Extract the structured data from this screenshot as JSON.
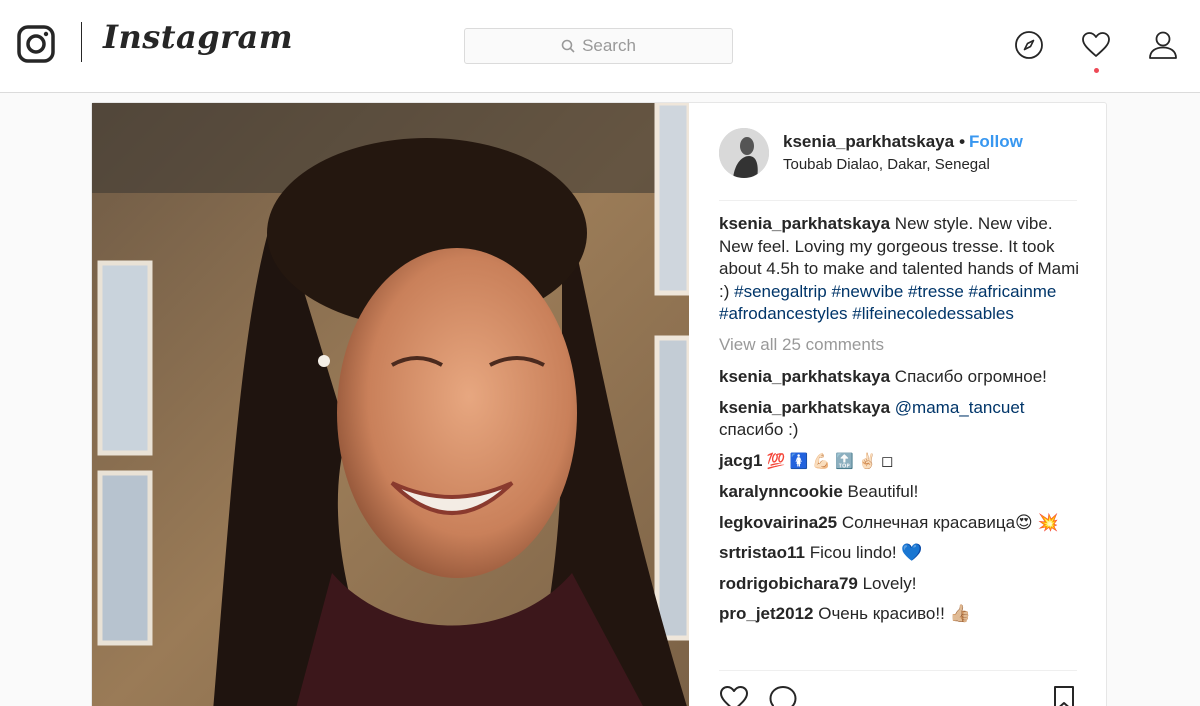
{
  "app": {
    "wordmark": "Instagram",
    "search_placeholder": "Search",
    "icons": [
      "instagram-glyph-icon",
      "search-icon",
      "compass-icon",
      "heart-icon",
      "person-icon"
    ],
    "colors": {
      "link_blue": "#3897f0",
      "hashtag": "#003569",
      "notification": "#ed4956",
      "muted": "#999999"
    }
  },
  "post": {
    "author": "ksenia_parkhatskaya",
    "separator": "•",
    "follow_label": "Follow",
    "location": "Toubab Dialao, Dakar, Senegal",
    "caption": {
      "user": "ksenia_parkhatskaya",
      "text": " New style. New vibe. New feel. Loving my gorgeous tresse. It took about 4.5h to make and talented hands of Mami :) ",
      "hashtags": [
        "#senegaltrip",
        "#newvibe",
        "#tresse",
        "#africainme",
        "#afrodancestyles",
        "#lifeinecoledessables"
      ]
    },
    "view_all_label": "View all 25 comments",
    "comments": [
      {
        "user": "ksenia_parkhatskaya",
        "text": " Спасибо огромное!"
      },
      {
        "user": "ksenia_parkhatskaya",
        "mention": "@mama_tancuet",
        "text": " спасибо :)"
      },
      {
        "user": "jacg1",
        "text": " 💯 🚺 💪🏻 🔝 ✌🏻 ◻"
      },
      {
        "user": "karalynncookie",
        "text": " Beautiful!"
      },
      {
        "user": "legkovairina25",
        "text": " Солнечная красавица😍 💥"
      },
      {
        "user": "srtristao11",
        "text": " Ficou lindo! 💙"
      },
      {
        "user": "rodrigobichara79",
        "text": " Lovely!"
      },
      {
        "user": "pro_jet2012",
        "text": " Очень красиво!! 👍🏼"
      }
    ]
  }
}
